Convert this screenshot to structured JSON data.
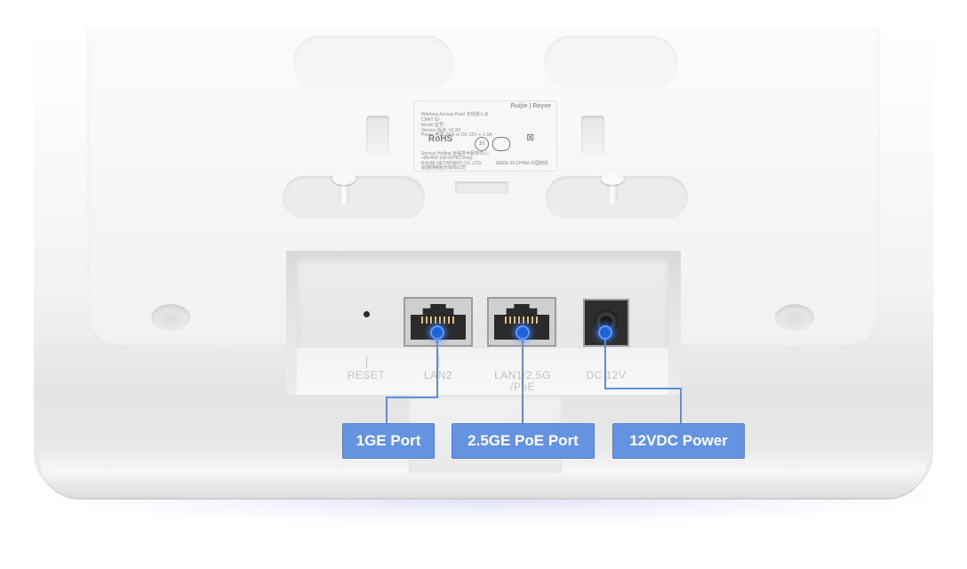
{
  "device": {
    "label": {
      "brand": "Ruijie | Reyee",
      "line1": "Wireless Access Point 无线接入点",
      "line2": "CMIIT ID:",
      "line3": "Model 型号:",
      "line4": "Version 版本: V1.00",
      "line5": "Power 电源: PoE or DC 12V ⎓ 1.5A",
      "rohs": "RoHS",
      "cert_mark": "10",
      "service": "Service Hotline 远程技术服务中心:",
      "phone": "+86-400-100-0078(China)",
      "company": "RUIJIE NETWORKS CO.,LTD.",
      "company_cn": "锐捷网络股份有限公司",
      "made_in": "MADE IN CHINA 中国制造"
    },
    "ports": {
      "reset_label": "RESET",
      "lan2_label": "LAN2",
      "lan1_label_line1": "LAN1/2.5G",
      "lan1_label_line2": "/PoE",
      "dc_label": "DC 12V"
    }
  },
  "callouts": [
    {
      "label": "1GE Port"
    },
    {
      "label": "2.5GE PoE Port"
    },
    {
      "label": "12VDC Power"
    }
  ],
  "colors": {
    "callout_fill": "#6494e0",
    "callout_dot": "#1f63d6",
    "device_body": "#f3f3f3"
  }
}
